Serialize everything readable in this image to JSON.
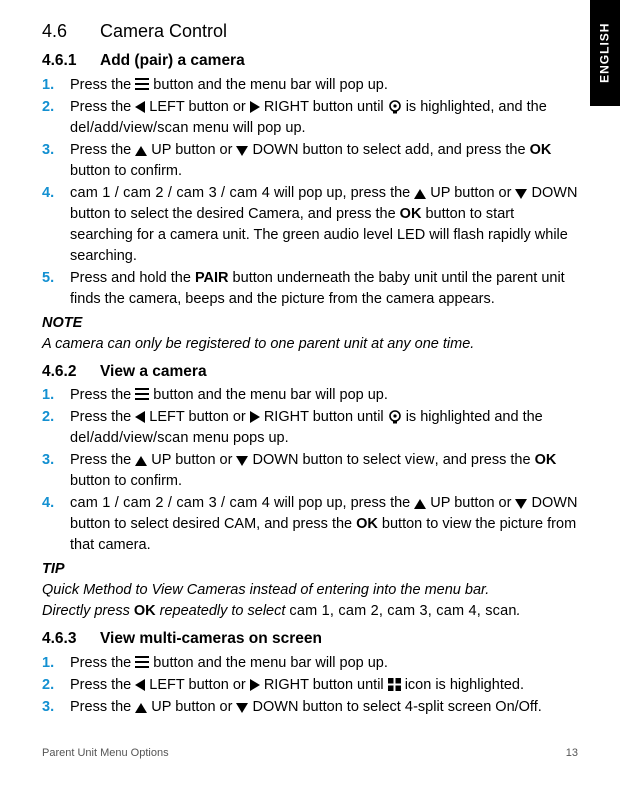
{
  "sideTab": "ENGLISH",
  "h1": {
    "num": "4.6",
    "title": "Camera Control"
  },
  "s461": {
    "num": "4.6.1",
    "title": "Add (pair) a camera",
    "steps": {
      "s1a": "Press the ",
      "s1b": " button and the menu bar will pop up.",
      "s2a": "Press the ",
      "s2b": " LEFT button or ",
      "s2c": " RIGHT button until ",
      "s2d": " is highlighted, and the ",
      "s2menu": "del/add/view/scan",
      "s2e": " menu will pop up.",
      "s3a": "Press the ",
      "s3b": " UP button or ",
      "s3c": " DOWN button to select ",
      "s3sel": "add",
      "s3d": ", and press the ",
      "s3ok": "OK",
      "s3e": " button to confirm.",
      "s4cams": "cam 1 / cam 2 / cam 3 / cam 4",
      "s4a": " will pop up, press the ",
      "s4b": " UP button or ",
      "s4c": " DOWN button to select the desired Camera, and press the ",
      "s4ok": "OK",
      "s4d": " button to start searching for a camera unit. The green audio level LED will flash rapidly while searching.",
      "s5a": "Press and hold the ",
      "s5pair": "PAIR",
      "s5b": " button underneath the baby unit until the parent unit finds the camera, beeps and the picture from the camera appears."
    },
    "noteH": "NOTE",
    "noteB": "A camera can only be registered to one parent unit at any one time."
  },
  "s462": {
    "num": "4.6.2",
    "title": "View a camera",
    "steps": {
      "s1a": "Press the ",
      "s1b": " button and the menu bar will pop up.",
      "s2a": "Press the ",
      "s2b": " LEFT button or ",
      "s2c": " RIGHT button until ",
      "s2d": " is highlighted and the ",
      "s2menu": "del/add/view/scan",
      "s2e": " menu pops up.",
      "s3a": "Press the ",
      "s3b": " UP button or ",
      "s3c": " DOWN button to select ",
      "s3sel": "view",
      "s3d": ", and press the ",
      "s3ok": "OK",
      "s3e": " button to confirm.",
      "s4cams": "cam 1 / cam 2 / cam 3 / cam 4",
      "s4a": " will pop up, press the ",
      "s4b": " UP button or ",
      "s4c": " DOWN button to select desired CAM, and press the ",
      "s4ok": "OK",
      "s4d": " button to view the picture from that camera."
    },
    "tipH": "TIP",
    "tipB1": "Quick Method to View Cameras instead of entering into the menu bar.",
    "tipB2a": "Directly press ",
    "tipOK": "OK",
    "tipB2b": " repeatedly to select ",
    "tipCams": "cam 1, cam 2, cam 3, cam 4, scan",
    "tipB2c": "."
  },
  "s463": {
    "num": "4.6.3",
    "title": "View multi-cameras on screen",
    "steps": {
      "s1a": "Press the ",
      "s1b": " button and the menu bar will pop up.",
      "s2a": "Press the ",
      "s2b": " LEFT button or ",
      "s2c": " RIGHT button until ",
      "s2d": " icon is highlighted.",
      "s3a": "Press the ",
      "s3b": " UP button or ",
      "s3c": " DOWN button to select ",
      "s3sel": "4",
      "s3d": "-split screen On/Off."
    }
  },
  "footer": {
    "left": "Parent Unit Menu Options",
    "right": "13"
  }
}
